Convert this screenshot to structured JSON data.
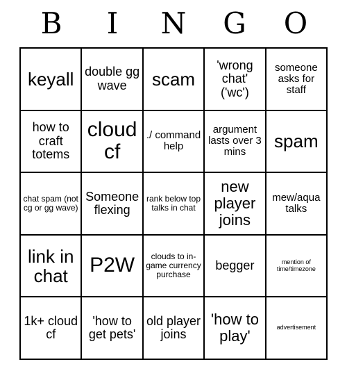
{
  "card": {
    "title_letters": [
      "B",
      "I",
      "N",
      "G",
      "O"
    ],
    "columns": 5,
    "rows": 5,
    "colors": {
      "background": "#ffffff",
      "grid_line": "#000000",
      "text": "#000000"
    },
    "cells": [
      [
        {
          "text": "keyall",
          "size": "xl"
        },
        {
          "text": "double gg wave",
          "size": "md"
        },
        {
          "text": "scam",
          "size": "xl"
        },
        {
          "text": "'wrong chat' ('wc')",
          "size": "md"
        },
        {
          "text": "someone asks for staff",
          "size": "sm"
        }
      ],
      [
        {
          "text": "how to craft totems",
          "size": "md"
        },
        {
          "text": "cloud cf",
          "size": "xxl"
        },
        {
          "text": "./ command help",
          "size": "sm"
        },
        {
          "text": "argument lasts over 3 mins",
          "size": "sm"
        },
        {
          "text": "spam",
          "size": "xl"
        }
      ],
      [
        {
          "text": "chat spam (not cg or gg wave)",
          "size": "xs"
        },
        {
          "text": "Someone flexing",
          "size": "md"
        },
        {
          "text": "rank below top talks in chat",
          "size": "xs"
        },
        {
          "text": "new player joins",
          "size": "lg"
        },
        {
          "text": "mew/aqua talks",
          "size": "sm"
        }
      ],
      [
        {
          "text": "link in chat",
          "size": "xl"
        },
        {
          "text": "P2W",
          "size": "xxl"
        },
        {
          "text": "clouds to in-game currency purchase",
          "size": "xs"
        },
        {
          "text": "begger",
          "size": "md"
        },
        {
          "text": "mention of time/timezone",
          "size": "xxs"
        }
      ],
      [
        {
          "text": "1k+ cloud cf",
          "size": "md"
        },
        {
          "text": "'how to get pets'",
          "size": "md"
        },
        {
          "text": "old player joins",
          "size": "md"
        },
        {
          "text": "'how to play'",
          "size": "lg"
        },
        {
          "text": "advertisement",
          "size": "xxs"
        }
      ]
    ]
  }
}
